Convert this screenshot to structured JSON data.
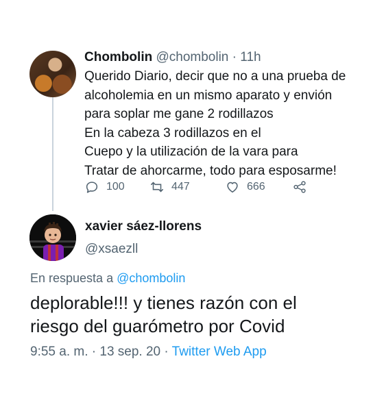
{
  "tweet1": {
    "display_name": "Chombolin",
    "handle": "@chombolin",
    "separator": "·",
    "time": "11h",
    "text_lines": [
      "Querido Diario, decir que no a una prueba de",
      "alcoholemia en un mismo aparato y envión",
      "para soplar me gane 2 rodillazos",
      "En la cabeza 3 rodillazos en el",
      "Cuepo y la utilización de la vara para",
      "Tratar de ahorcarme, todo para esposarme!"
    ],
    "actions": {
      "reply_count": "100",
      "retweet_count": "447",
      "like_count": "666"
    }
  },
  "tweet2": {
    "display_name": "xavier sáez-llorens",
    "handle": "@xsaezll",
    "reply_prefix": "En respuesta a",
    "reply_mention": "@chombolin",
    "text_lines": [
      "deplorable!!! y tienes razón con el",
      "riesgo del guarómetro por Covid"
    ],
    "timestamp": "9:55 a. m. · 13 sep. 20 ·",
    "source": "Twitter Web App"
  },
  "colors": {
    "text": "#14171a",
    "secondary": "#536471",
    "link": "#1d9bf0",
    "thread_line": "#c9d3dc"
  }
}
